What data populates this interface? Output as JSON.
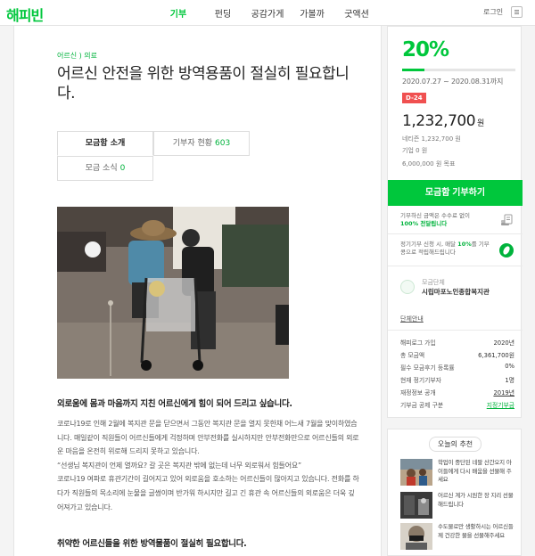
{
  "header": {
    "logo": "해피빈",
    "nav": [
      "기부",
      "펀딩",
      "공감가게",
      "가볼까",
      "굿액션"
    ],
    "active_nav": "기부",
    "login": "로그인",
    "colors": {
      "brand": "#00c73c"
    }
  },
  "article": {
    "category": "어르신 ) 의료",
    "title": "어르신 안전을 위한 방역용품이 절실히 필요합니다.",
    "tabs": {
      "intro": "모금함 소개",
      "donors": "기부자 현황",
      "donors_count": "603",
      "news": "모금 소식",
      "news_count": "0"
    },
    "lead": "외로움에 몸과 마음까지 지친 어르신에게 힘이 되어 드리고 싶습니다.",
    "paragraphs": [
      "코로나19로 인해 2월에 복지관 문을 닫으면서 그동안 복지관 문을 열지 못한채 어느새 7월을 맞이하였습니다. 매일같이 직원들이 어르신들에게 걱정하며 안부전화를 실시하지만 안부전화만으로 어르신들의 외로운 마음을 온전히 위로해 드리지 못하고 있습니다.",
      "“선생님 복지관이 언제 열까요? 갈 곳은 복지관 밖에 없는데 너무 외로워서 힘들어요”",
      "코로나19 여파로 휴관기간이 길어지고 있어 외로움을 호소하는 어르신들이 많아지고 있습니다. 전화를 하다가 직원들의 목소리에 눈물을 글썽이며 반가워 하시지만 길고 긴 휴관 속 어르신들의 외로움은 더욱 깊어져가고 있습니다."
    ],
    "subhead": "취약한 어르신들을 위한 방역물품이 절실히 필요합니다."
  },
  "campaign": {
    "percent_label": "20%",
    "progress": 0.2,
    "period": "2020.07.27 ~ 2020.08.31까지",
    "dday": "D-24",
    "amount": "1,232,700",
    "amount_unit": "원",
    "netizen": "네티즌 1,232,700 원",
    "company": "기업 0 원",
    "goal": "6,000,000 원 목표",
    "donate_button": "모금함 기부하기",
    "info1_pre": "기부하신 금액은 수수료 없이",
    "info1_strong": "100% 전달됩니다",
    "info2_pre": "정기기부 신청 시, 매달",
    "info2_strong": "10%",
    "info2_post": "를 기부콩으로 적립해드립니다",
    "org_label": "모금단체",
    "org_name": "시립마포노인종합복지관",
    "org_link": "단체안내",
    "stats": [
      {
        "label": "해피로그 가입",
        "value": "2020년"
      },
      {
        "label": "총 모금액",
        "value": "6,361,700원"
      },
      {
        "label": "필수 모금후기 등록률",
        "value": "0%"
      },
      {
        "label": "현재 정기기부자",
        "value": "1명"
      },
      {
        "label": "재정정보 공개",
        "value": "2019년"
      },
      {
        "label": "기부금 공제 구분",
        "value": "지정기부금"
      }
    ]
  },
  "recommend": {
    "title": "오늘의 추천",
    "items": [
      {
        "text": "학업이 중단된 네팔 산간오지 아이들에게 다시 배움을 선물해 주세요"
      },
      {
        "text": "어르신 계가 시원한 장 지리 선물해드립니다"
      },
      {
        "text": "수도물로만 생활하시는 어르신들께 건강한 물을 선물해주세요"
      }
    ]
  }
}
